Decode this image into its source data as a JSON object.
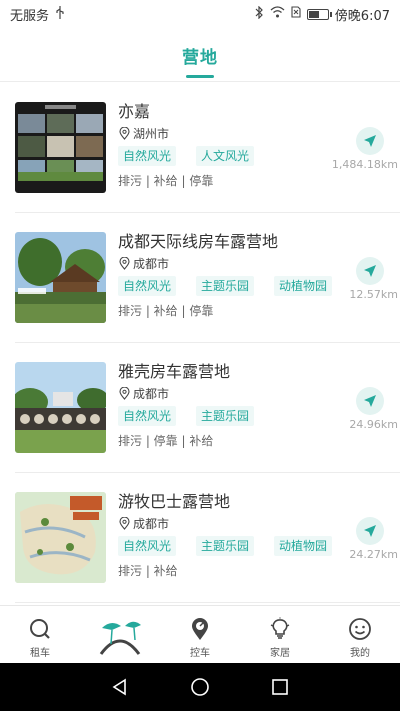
{
  "status": {
    "carrier": "无服务",
    "usb_icon": "usb-icon",
    "right_icons": [
      "bluetooth-icon",
      "wifi-icon",
      "no-sim-icon",
      "battery-icon"
    ],
    "time": "傍晚6:07",
    "battery_level": 0.6
  },
  "header": {
    "title": "营地"
  },
  "camps": [
    {
      "title": "亦嘉",
      "city": "湖州市",
      "tags": [
        "自然风光",
        "人文风光"
      ],
      "services": "排污 | 补给 | 停靠",
      "distance": "1,484.18km"
    },
    {
      "title": "成都天际线房车露营地",
      "city": "成都市",
      "tags": [
        "自然风光",
        "主题乐园",
        "动植物园"
      ],
      "services": "排污 | 补给 | 停靠",
      "distance": "12.57km"
    },
    {
      "title": "雅壳房车露营地",
      "city": "成都市",
      "tags": [
        "自然风光",
        "主题乐园"
      ],
      "services": "排污 | 停靠 | 补给",
      "distance": "24.96km"
    },
    {
      "title": "游牧巴士露营地",
      "city": "成都市",
      "tags": [
        "自然风光",
        "主题乐园",
        "动植物园"
      ],
      "services": "排污 | 补给",
      "distance": "24.27km"
    }
  ],
  "tabbar": {
    "items": [
      {
        "label": "租车",
        "icon": "search-icon"
      },
      {
        "label": "",
        "icon": "camp-umbrella-icon"
      },
      {
        "label": "控车",
        "icon": "steering-pin-icon"
      },
      {
        "label": "家居",
        "icon": "lightbulb-icon"
      },
      {
        "label": "我的",
        "icon": "smiley-icon"
      }
    ]
  },
  "colors": {
    "accent": "#25a99c",
    "tag_bg": "#eef8f7",
    "distance": "#a8a8a8"
  }
}
